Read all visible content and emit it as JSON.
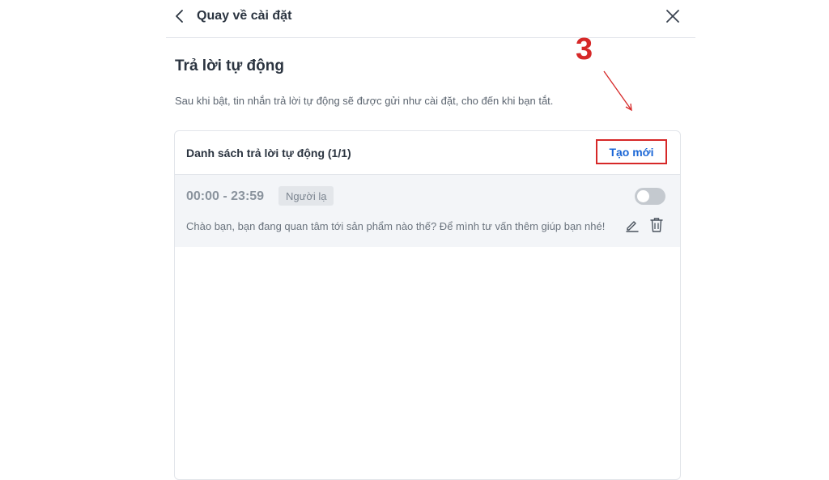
{
  "header": {
    "back_label": "Quay về cài đặt"
  },
  "page": {
    "title": "Trả lời tự động",
    "description": "Sau khi bật, tin nhắn trả lời tự động sẽ được gửi như cài đặt, cho đến khi bạn tắt."
  },
  "list": {
    "title": "Danh sách trả lời tự động (1/1)",
    "new_button_label": "Tạo mới",
    "items": [
      {
        "time_range": "00:00 - 23:59",
        "audience": "Người lạ",
        "message": "Chào bạn, bạn đang quan tâm tới sản phẩm nào thế? Để mình tư vấn thêm giúp bạn nhé!",
        "enabled": false
      }
    ]
  },
  "annotation": {
    "step_number": "3",
    "color": "#d62828"
  },
  "colors": {
    "accent": "#1a66d6",
    "highlight_box": "#d62828",
    "toggle_off": "#c4c9cf",
    "item_background": "#f3f5f8"
  },
  "icons": [
    "chevron-left-icon",
    "close-icon",
    "pencil-icon",
    "trash-icon"
  ]
}
